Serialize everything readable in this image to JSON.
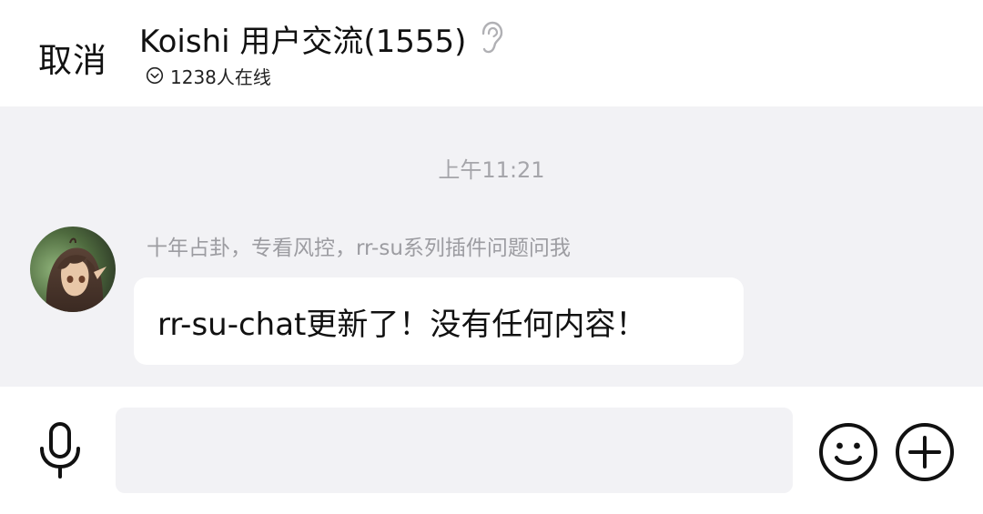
{
  "header": {
    "cancel_label": "取消",
    "title": "Koishi 用户交流(1555)",
    "online_text": "1238人在线"
  },
  "chat": {
    "time_divider": "上午11:21",
    "messages": [
      {
        "sender": "十年占卦，专看风控，rr-su系列插件问题问我",
        "text": "rr-su-chat更新了！没有任何内容！"
      }
    ]
  },
  "input_bar": {
    "placeholder": "",
    "value": ""
  },
  "icons": {
    "ear": "ear-icon",
    "online_toggle": "chevron-down-circle-icon",
    "voice": "microphone-icon",
    "emoji": "smiley-icon",
    "more": "plus-circle-icon"
  },
  "colors": {
    "chat_background": "#f2f2f5",
    "bubble_background": "#ffffff",
    "secondary_text": "#9c9ca1"
  }
}
